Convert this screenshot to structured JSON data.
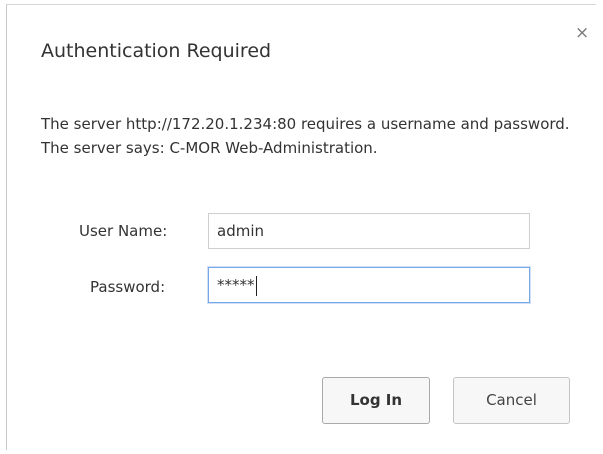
{
  "dialog": {
    "title": "Authentication Required",
    "close_glyph": "×",
    "message": "The server http://172.20.1.234:80 requires a username and password. The server says: C-MOR Web-Administration.",
    "username": {
      "label": "User Name:",
      "value": "admin"
    },
    "password": {
      "label": "Password:",
      "value": "*****"
    },
    "buttons": {
      "login": "Log In",
      "cancel": "Cancel"
    }
  },
  "colors": {
    "focus_border": "#76a7e8",
    "text": "#333333",
    "button_bg": "#f7f7f7"
  },
  "icons": [
    "close-icon"
  ]
}
